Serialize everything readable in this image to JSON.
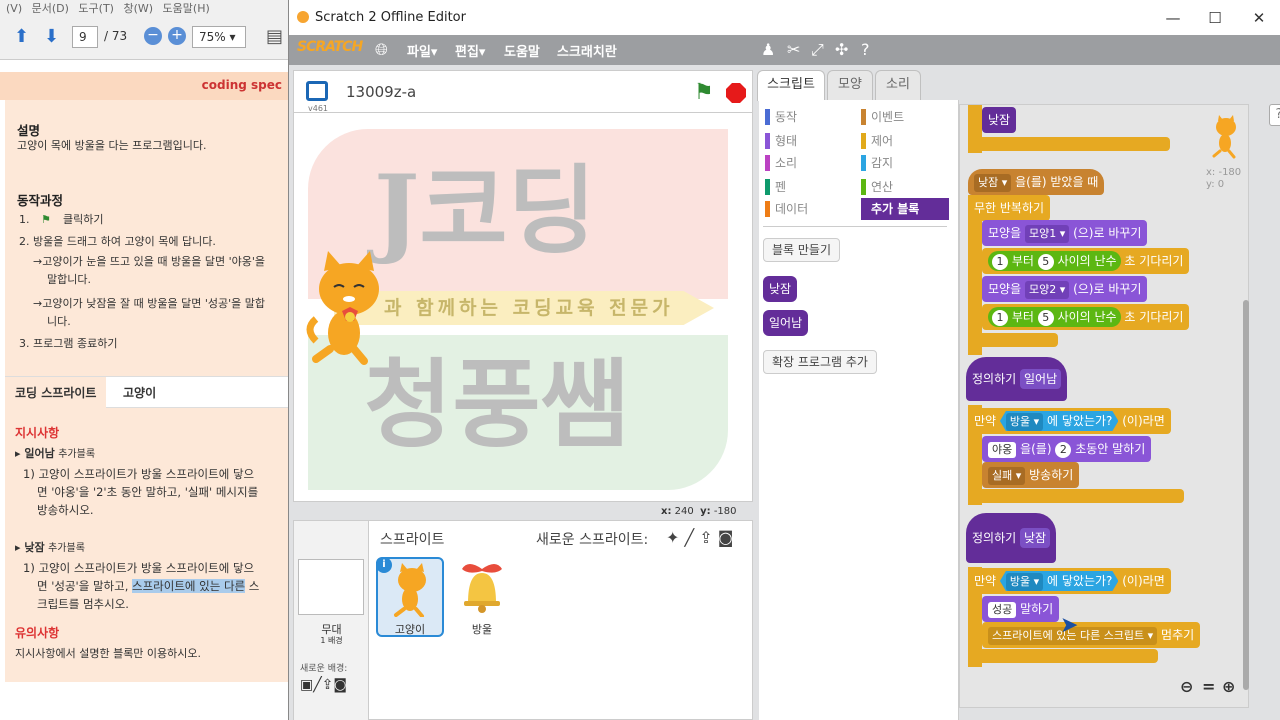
{
  "doc": {
    "menu": [
      "(V)",
      "문서(D)",
      "도구(T)",
      "창(W)",
      "도움말(H)"
    ],
    "page_current": "9",
    "page_total": "/ 73",
    "zoom": "75%",
    "logo_text": "coding spec",
    "sec1_title": "설명",
    "sec1_text": "고양이 목에 방울을 다는 프로그램입니다.",
    "sec2_title": "동작과정",
    "step1": "1.",
    "step1_text": "클릭하기",
    "step2": "2. 방울을 드래그 하여 고양이 목에 답니다.",
    "step2_a1": "→고양이가 눈을 뜨고 있을 때 방울을 달면 '야옹'을",
    "step2_a2": "말합니다.",
    "step2_b1": "→고양이가 낮잠을 잘 때 방울을 달면 '성공'을 말합",
    "step2_b2": "니다.",
    "step3": "3. 프로그램 종료하기",
    "tab_coding": "코딩 스프라이트",
    "tab_cat": "고양이",
    "inst_title": "지시사항",
    "inst1_name": "▸ 일어남",
    "inst1_tag": "추가블록",
    "inst1_l1": "1) 고양이 스프라이트가 방울 스프라이트에 닿으",
    "inst1_l2": "면 '야옹'을 '2'초 동안 말하고, '실패' 메시지를",
    "inst1_l3": "방송하시오.",
    "inst2_name": "▸ 낮잠",
    "inst2_tag": "추가블록",
    "inst2_l1": "1) 고양이 스프라이트가 방울 스프라이트에 닿으",
    "inst2_l2a": "면 '성공'을 말하고, ",
    "inst2_l2b": "스프라이트에 있는 다른",
    "inst2_l2c": " 스",
    "inst2_l3": "크립트를 멈추시오.",
    "note_title": "유의사항",
    "note_text": "지시사항에서 설명한 블록만 이용하시오."
  },
  "window": {
    "title": "Scratch 2 Offline Editor",
    "minimize": "—",
    "maximize": "☐",
    "close": "✕"
  },
  "menubar": {
    "logo": "SCRATCH",
    "file": "파일▾",
    "edit": "편집▾",
    "help": "도움말",
    "tips": "스크래치란"
  },
  "stage": {
    "version": "v461",
    "project_title": "13009z-a",
    "coord_x_label": "x:",
    "coord_x": "240",
    "coord_y_label": "y:",
    "coord_y": "-180",
    "banner_text": "과 함께하는 코딩교육 전문가",
    "watermark_top": "J코딩",
    "watermark_bottom": "청풍쌤"
  },
  "sprites": {
    "header": "스프라이트",
    "new_sprite": "새로운 스프라이트:",
    "stage_label": "무대",
    "stage_sub": "1 배경",
    "new_backdrop": "새로운 배경:",
    "items": [
      {
        "name": "고양이"
      },
      {
        "name": "방울"
      }
    ]
  },
  "tabs": {
    "scripts": "스크립트",
    "costumes": "모양",
    "sounds": "소리"
  },
  "categories": {
    "motion": "동작",
    "looks": "형태",
    "sound": "소리",
    "pen": "펜",
    "data": "데이터",
    "events": "이벤트",
    "control": "제어",
    "sensing": "감지",
    "operators": "연산",
    "more": "추가 블록"
  },
  "palette": {
    "make_block": "블록 만들기",
    "block1": "낮잠",
    "block2": "일어남",
    "extension": "확장 프로그램 추가"
  },
  "script": {
    "b_nap_top": "낮잠",
    "when_recv_msg": "낮잠",
    "when_recv_text": "을(를) 받았을 때",
    "forever": "무한 반복하기",
    "switch1_a": "모양을",
    "switch1_slot": "모양1",
    "switch1_b": "(으)로 바꾸기",
    "wait_a": "1",
    "wait_from": "부터",
    "wait_b": "5",
    "wait_rand": "사이의 난수",
    "wait_c": "초 기다리기",
    "switch2_slot": "모양2",
    "define_text": "정의하기",
    "define1": "일어남",
    "if_text": "만약",
    "touch_obj": "방울",
    "touch_text": "에 닿았는가?",
    "then_text": "(이)라면",
    "say_msg": "야옹",
    "say_for_text": "을(를)",
    "say_secs": "2",
    "say_for_tail": "초동안 말하기",
    "broadcast_msg": "실패",
    "broadcast_text": "방송하기",
    "define2": "낮잠",
    "say2_msg": "성공",
    "say2_text": "말하기",
    "stop_slot": "스프라이트에 있는 다른 스크립트",
    "stop_text": "멈추기"
  },
  "sprite_info": {
    "x": "x: -180",
    "y": "y: 0"
  },
  "zoom": {
    "out": "🔍︎−",
    "reset": "=",
    "in": "🔍︎+"
  },
  "colors": {
    "events": "#c88330",
    "control": "#e6a922",
    "looks": "#8a55d7",
    "operators": "#5cb712",
    "sensing": "#2ca5e2",
    "more_blocks": "#632d99"
  }
}
